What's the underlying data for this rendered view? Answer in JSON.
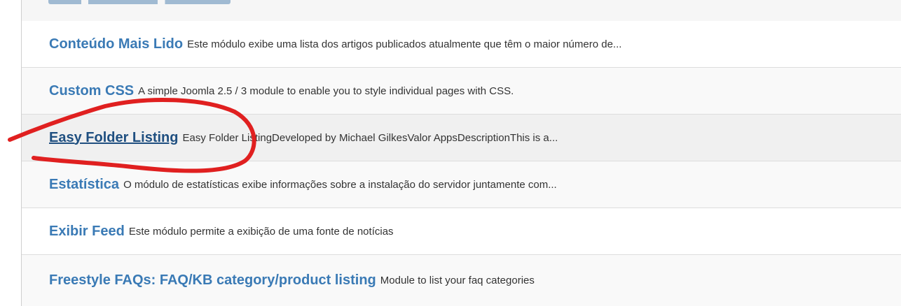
{
  "modules": [
    {
      "title": "Conteúdo Mais Lido",
      "description": "Este módulo exibe uma lista dos artigos publicados atualmente que têm o maior número de..."
    },
    {
      "title": "Custom CSS",
      "description": "A simple Joomla 2.5 / 3 module to enable you to style individual pages with CSS."
    },
    {
      "title": "Easy Folder Listing",
      "description": "Easy Folder ListingDeveloped by Michael GilkesValor AppsDescriptionThis is a..."
    },
    {
      "title": "Estatística",
      "description": "O módulo de estatísticas exibe informações sobre a instalação do servidor juntamente com..."
    },
    {
      "title": "Exibir Feed",
      "description": "Este módulo permite a exibição de uma fonte de notícias"
    },
    {
      "title": "Freestyle FAQs: FAQ/KB category/product listing",
      "description": "Module to list your faq categories"
    }
  ],
  "annotation": {
    "color": "#e02020"
  }
}
